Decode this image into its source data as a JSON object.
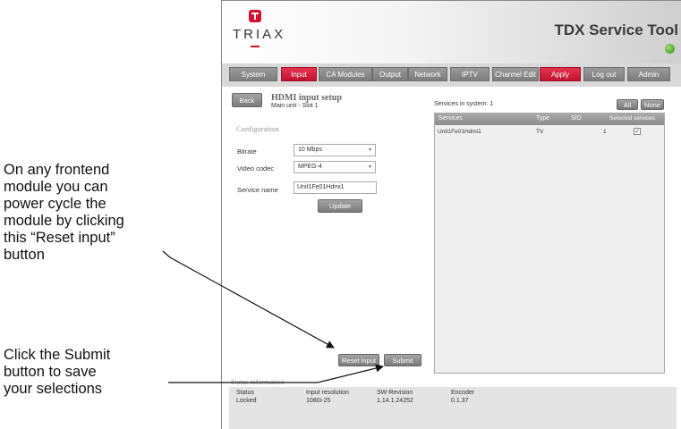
{
  "callouts": {
    "reset": "On any frontend\nmodule you can\npower cycle the\nmodule by clicking\nthis “Reset input”\nbutton",
    "submit": "Click the Submit\nbutton to save\nyour selections"
  },
  "header": {
    "logo_text": "TRIAX",
    "app_title": "TDX Service Tool",
    "status_color": "#3a9a1e"
  },
  "nav": {
    "tabs": [
      "System",
      "Input",
      "CA Modules",
      "Output",
      "Network",
      "IPTV",
      "Channel Edit"
    ],
    "active_tab": "Input",
    "right_buttons": [
      "Apply",
      "Log out",
      "Admin"
    ]
  },
  "left": {
    "back_label": "Back",
    "title": "HDMI input setup",
    "subtitle": "Main unit - Slot 1",
    "section_label": "Configuration",
    "fields": {
      "bitrate_label": "Bitrate",
      "bitrate_value": "10 Mbps",
      "codec_label": "Video codec",
      "codec_value": "MPEG-4",
      "service_label": "Service name",
      "service_value": "Unit1Fe01Hdmi1"
    },
    "update_label": "Update",
    "reset_label": "Reset input",
    "submit_label": "Submit"
  },
  "services": {
    "title": "Services in system: 1",
    "buttons": [
      "All",
      "None"
    ],
    "columns": [
      "Services",
      "Type",
      "SID",
      "Selected services"
    ],
    "rows": [
      {
        "service": "Unit1Fe01Hdmi1",
        "type": "TV",
        "sid": "1",
        "selected": "✓"
      }
    ]
  },
  "status": {
    "title": "Status information",
    "columns": [
      "Status",
      "Input resolution",
      "SW-Revision",
      "Encoder"
    ],
    "values": [
      "Locked",
      "1080i-25",
      "1.14.1.24252",
      "0.1.37"
    ]
  }
}
